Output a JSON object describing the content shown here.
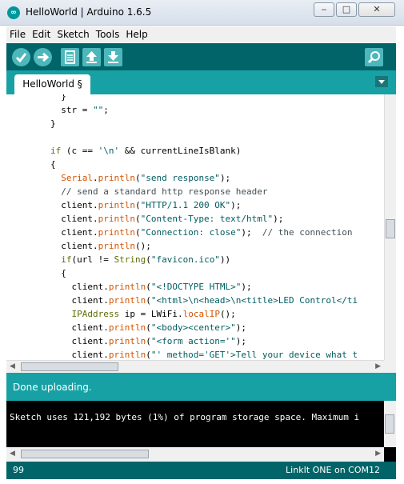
{
  "window": {
    "title": "HelloWorld | Arduino 1.6.5",
    "app_icon": "arduino-logo",
    "min_glyph": "‒",
    "max_glyph": "□",
    "close_glyph": "✕"
  },
  "menu": [
    "File",
    "Edit",
    "Sketch",
    "Tools",
    "Help"
  ],
  "toolbar": {
    "buttons": [
      {
        "name": "verify",
        "icon": "check-icon"
      },
      {
        "name": "upload",
        "icon": "arrow-right-icon"
      },
      {
        "name": "new",
        "icon": "document-icon"
      },
      {
        "name": "open",
        "icon": "arrow-up-icon"
      },
      {
        "name": "save",
        "icon": "arrow-down-icon"
      },
      {
        "name": "serial-monitor",
        "icon": "magnifier-icon"
      }
    ]
  },
  "tabs": [
    {
      "label": "HelloWorld §",
      "active": true
    }
  ],
  "editor": {
    "lines": [
      "          }",
      "          str = \"\";",
      "        }",
      "",
      "        if (c == '\\n' && currentLineIsBlank)",
      "        {",
      "          Serial.println(\"send response\");",
      "          // send a standard http response header",
      "          client.println(\"HTTP/1.1 200 OK\");",
      "          client.println(\"Content-Type: text/html\");",
      "          client.println(\"Connection: close\");  // the connection",
      "          client.println();",
      "          if(url != String(\"favicon.ico\"))",
      "          {",
      "            client.println(\"<!DOCTYPE HTML>\");",
      "            client.println(\"<html>\\n<head>\\n<title>LED Control</ti",
      "            IPAddress ip = LWiFi.localIP();",
      "            client.println(\"<body><center>\");",
      "            client.println(\"<form action='\");",
      "            client.println(\"' method='GET'>Tell your device what t"
    ]
  },
  "status": {
    "message": "Done uploading."
  },
  "console": {
    "text": "Sketch uses 121,192 bytes (1%) of program storage space. Maximum i"
  },
  "footer": {
    "line": "99",
    "board": "LinkIt ONE on COM12"
  },
  "colors": {
    "toolbar": "#006468",
    "tabbar": "#17a1a5",
    "button": "#4db7bb",
    "keyword": "#5e6d03",
    "function": "#d35400",
    "string": "#005c5f"
  }
}
